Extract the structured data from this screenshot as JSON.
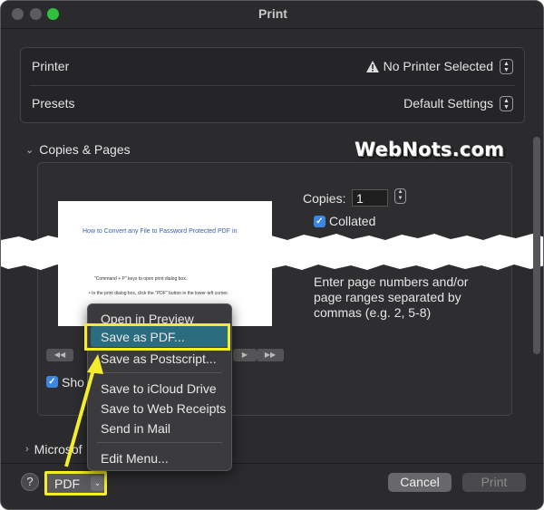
{
  "window": {
    "title": "Print"
  },
  "printer": {
    "label": "Printer",
    "value": "No Printer Selected",
    "status_icon": "warning-icon"
  },
  "presets": {
    "label": "Presets",
    "value": "Default Settings"
  },
  "copies_pages": {
    "section_label": "Copies & Pages",
    "copies_label": "Copies:",
    "copies_value": "1",
    "collated_label": "Collated",
    "collated_checked": true,
    "pages_hint": "Enter page numbers and/or page ranges separated by commas (e.g. 2, 5-8)",
    "preview": {
      "doc_title": "How to Convert any File to Password Protected PDF in",
      "line1": "\"Command + P\" keys to open print dialog box.",
      "line2": "• In the print dialog box, click the \"PDF\" button in the lower-left corner."
    },
    "nav": {
      "first": "◀◀",
      "next": "▶",
      "last": "▶▶"
    },
    "show_label": "Sho",
    "show_checked": true
  },
  "microsoft_section": {
    "label": "Microsof"
  },
  "watermark": "WebNots.com",
  "bottom": {
    "help_label": "?",
    "pdf_label": "PDF",
    "cancel_label": "Cancel",
    "print_label": "Print"
  },
  "pdf_menu": {
    "items": [
      "Open in Preview",
      "Save as PDF...",
      "Save as Postscript...",
      "Save to iCloud Drive",
      "Save to Web Receipts",
      "Send in Mail",
      "Edit Menu..."
    ],
    "highlighted": "Save as PDF..."
  },
  "colors": {
    "highlight_outline": "#f5ec2c",
    "menu_selection": "#2a6d7f",
    "checkbox": "#3a86e0",
    "window_bg": "#2b2b2d"
  }
}
